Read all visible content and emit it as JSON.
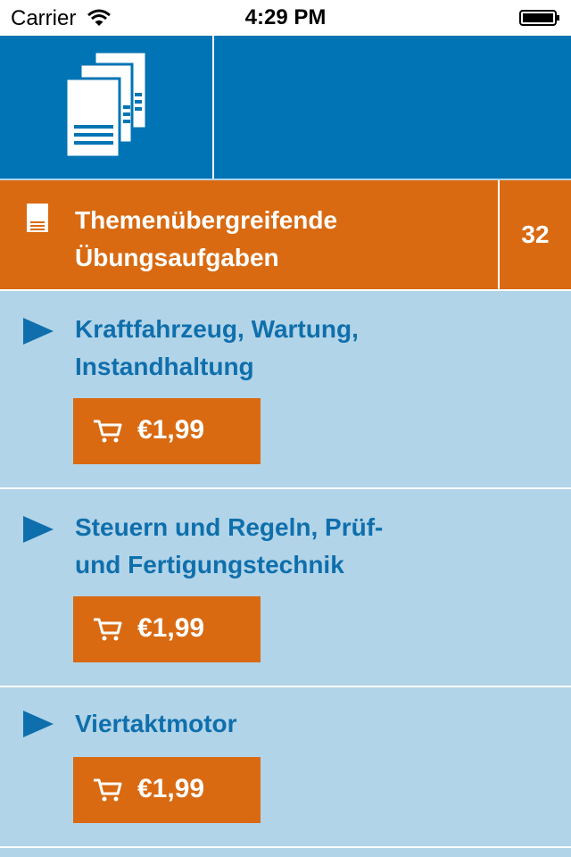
{
  "status_bar": {
    "carrier": "Carrier",
    "time": "4:29 PM"
  },
  "category": {
    "title_line1": "Themenübergreifende",
    "title_line2": "Übungsaufgaben",
    "count": "32"
  },
  "items": [
    {
      "title_line1": "Kraftfahrzeug, Wartung,",
      "title_line2": "Instandhaltung",
      "price": "€1,99"
    },
    {
      "title_line1": "Steuern und Regeln, Prüf-",
      "title_line2": "und Fertigungstechnik",
      "price": "€1,99"
    },
    {
      "title_line1": "Viertaktmotor",
      "title_line2": "",
      "price": "€1,99"
    }
  ],
  "colors": {
    "header_blue": "#0074b4",
    "orange": "#d96a11",
    "list_bg": "#b2d4e8",
    "title_blue": "#0f6fac"
  },
  "icons": {
    "header": "documents-icon",
    "category": "document-icon",
    "item": "play-arrow-icon",
    "buy": "cart-icon"
  }
}
